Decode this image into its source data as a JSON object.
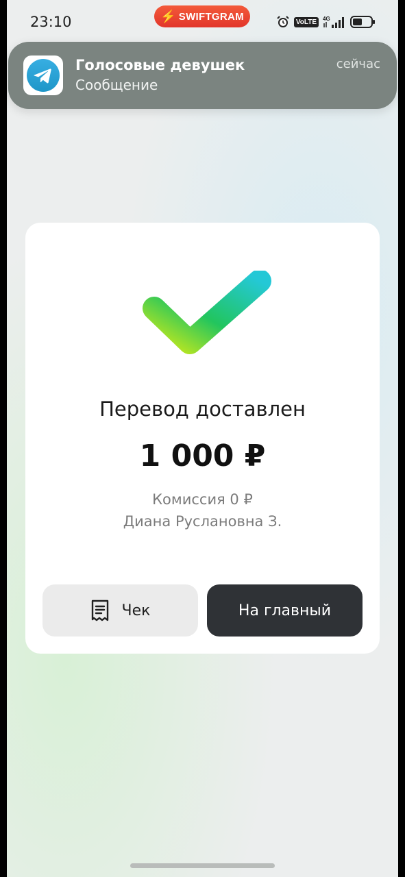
{
  "status_bar": {
    "time": "23:10",
    "badge_label": "SWIFTGRAM",
    "network_label": "VoLTE",
    "network_type": "4G",
    "icons": [
      "alarm-icon",
      "volte-icon",
      "signal-icon",
      "battery-icon"
    ]
  },
  "notification": {
    "app_icon": "telegram-icon",
    "title": "Голосовые девушек",
    "body": "Сообщение",
    "time": "сейчас"
  },
  "card": {
    "status_icon": "check-icon",
    "title": "Перевод доставлен",
    "amount": "1 000 ₽",
    "fee": "Комиссия 0 ₽",
    "recipient": "Диана Руслановна З.",
    "receipt_button": "Чек",
    "home_button": "На главный"
  },
  "colors": {
    "badge": "#e2352a",
    "notification_bg": "#7b8480",
    "telegram_blue": "#2aa3e0",
    "check_green": "#22c55e",
    "check_cyan": "#24c8d6",
    "primary_button": "#2f3236",
    "secondary_button": "#ebebeb"
  }
}
